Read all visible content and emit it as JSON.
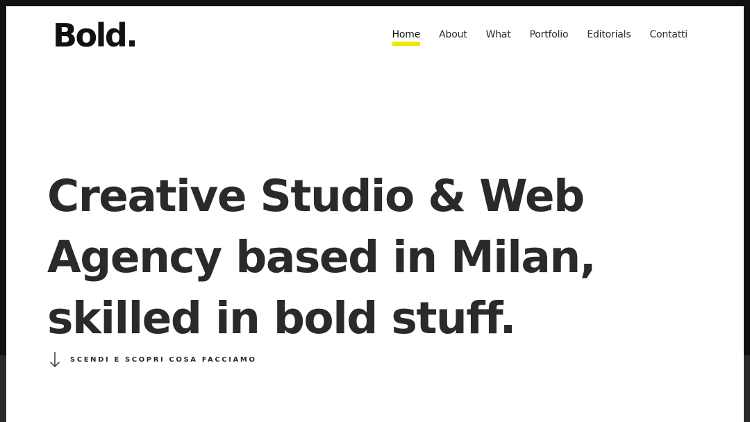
{
  "brand": {
    "logo_text": "Bold."
  },
  "nav": {
    "items": [
      {
        "label": "Home",
        "active": true
      },
      {
        "label": "About",
        "active": false
      },
      {
        "label": "What",
        "active": false
      },
      {
        "label": "Portfolio",
        "active": false
      },
      {
        "label": "Editorials",
        "active": false
      },
      {
        "label": "Contatti",
        "active": false
      }
    ],
    "active_underline_color": "#f2e600"
  },
  "hero": {
    "lines": [
      "Creative Studio & Web",
      "Agency based in Milan,",
      "skilled in bold stuff."
    ]
  },
  "scroll_cta": {
    "label": "SCENDI E SCOPRI COSA FACCIAMO",
    "icon": "arrow-down-icon"
  },
  "colors": {
    "text": "#2a2a2a",
    "background": "#ffffff",
    "frame": "#111111"
  }
}
